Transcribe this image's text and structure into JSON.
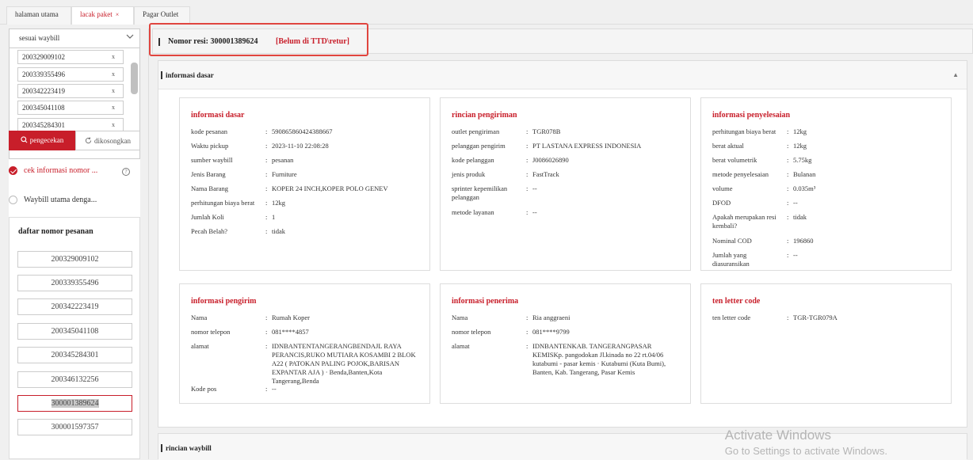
{
  "tabs": [
    {
      "label": "halaman utama",
      "active": false
    },
    {
      "label": "lacak paket",
      "active": true,
      "close": "×"
    },
    {
      "label": "Pagar Outlet",
      "active": false
    }
  ],
  "sidebar": {
    "select_value": "sesuai waybill",
    "waybills": [
      "200329009102",
      "200339355496",
      "200342223419",
      "200345041108",
      "200345284301"
    ],
    "remove_icon": "x",
    "check_button": "pengecekan",
    "clear_button": "dikosongkan",
    "option_one": "cek informasi nomor ...",
    "option_two": "Waybill utama denga...",
    "order_title": "daftar nomor pesanan",
    "orders": [
      "200329009102",
      "200339355496",
      "200342223419",
      "200345041108",
      "200345284301",
      "200346132256",
      "300001389624",
      "300001597357"
    ],
    "selected_order": "300001389624"
  },
  "resi": {
    "label": "Nomor resi:  300001389624",
    "status": "[Belum di TTD\\retur]"
  },
  "basic_section": {
    "title": "informasi dasar"
  },
  "waybill_section": {
    "title": "rincian waybill"
  },
  "cards": {
    "dasar": {
      "title": "informasi dasar",
      "rows": [
        {
          "k": "kode pesanan",
          "v": "590865860424388667"
        },
        {
          "k": "Waktu pickup",
          "v": "2023-11-10 22:08:28"
        },
        {
          "k": "sumber waybill",
          "v": "pesanan"
        },
        {
          "k": "Jenis Barang",
          "v": "Furniture"
        },
        {
          "k": "Nama Barang",
          "v": "KOPER 24 INCH,KOPER POLO GENEV"
        },
        {
          "k": "perhitungan biaya berat",
          "v": "12kg"
        },
        {
          "k": "Jumlah Koli",
          "v": "1"
        },
        {
          "k": "Pecah Belah?",
          "v": "tidak"
        }
      ]
    },
    "pengiriman": {
      "title": "rincian pengiriman",
      "rows": [
        {
          "k": "outlet pengiriman",
          "v": "TGR078B"
        },
        {
          "k": "pelanggan pengirim",
          "v": "PT LASTANA EXPRESS INDONESIA"
        },
        {
          "k": "kode pelanggan",
          "v": "J0086026890"
        },
        {
          "k": "jenis produk",
          "v": "FastTrack"
        },
        {
          "k": "sprinter kepemilikan pelanggan",
          "v": "--"
        },
        {
          "k": "metode layanan",
          "v": "--"
        }
      ]
    },
    "penyelesaian": {
      "title": "informasi penyelesaian",
      "rows": [
        {
          "k": "perhitungan biaya berat",
          "v": "12kg"
        },
        {
          "k": "berat aktual",
          "v": "12kg"
        },
        {
          "k": "berat volumetrik",
          "v": "5.75kg"
        },
        {
          "k": "metode penyelesaian",
          "v": "Bulanan"
        },
        {
          "k": "volume",
          "v": "0.035m³"
        },
        {
          "k": "DFOD",
          "v": "--"
        },
        {
          "k": "Apakah merupakan resi kembali?",
          "v": "tidak"
        },
        {
          "k": "Nominal COD",
          "v": "196860"
        },
        {
          "k": "Jumlah yang diasuransikan",
          "v": "--"
        }
      ]
    },
    "pengirim": {
      "title": "informasi pengirim",
      "rows": [
        {
          "k": "Nama",
          "v": "Rumah Koper"
        },
        {
          "k": "nomor telepon",
          "v": "081****4857"
        },
        {
          "k": "alamat",
          "v": "IDNBANTENTANGERANGBENDAJL RAYA PERANCIS,RUKO MUTIARA KOSAMBI 2 BLOK A22 ( PATOKAN PALING POJOK,BARISAN EXPANTAR AJA ) · Benda,Banten,Kota Tangerang,Benda"
        },
        {
          "k": "Kode pos",
          "v": "--"
        }
      ]
    },
    "penerima": {
      "title": "informasi penerima",
      "rows": [
        {
          "k": "Nama",
          "v": "Ria anggraeni"
        },
        {
          "k": "nomor telepon",
          "v": "081****9799"
        },
        {
          "k": "alamat",
          "v": "IDNBANTENKAB. TANGERANGPASAR KEMISKp. pangodokan Jl.kinada no 22 rt.04/06 kutabumi - pasar kemis · Kutabumi (Kuta Bumi), Banten, Kab. Tangerang, Pasar Kemis"
        }
      ]
    },
    "tenletter": {
      "title": "ten letter code",
      "rows": [
        {
          "k": "ten letter code",
          "v": "TGR-TGR079A"
        }
      ]
    }
  },
  "watermark": {
    "line1": "Activate Windows",
    "line2": "Go to Settings to activate Windows."
  }
}
